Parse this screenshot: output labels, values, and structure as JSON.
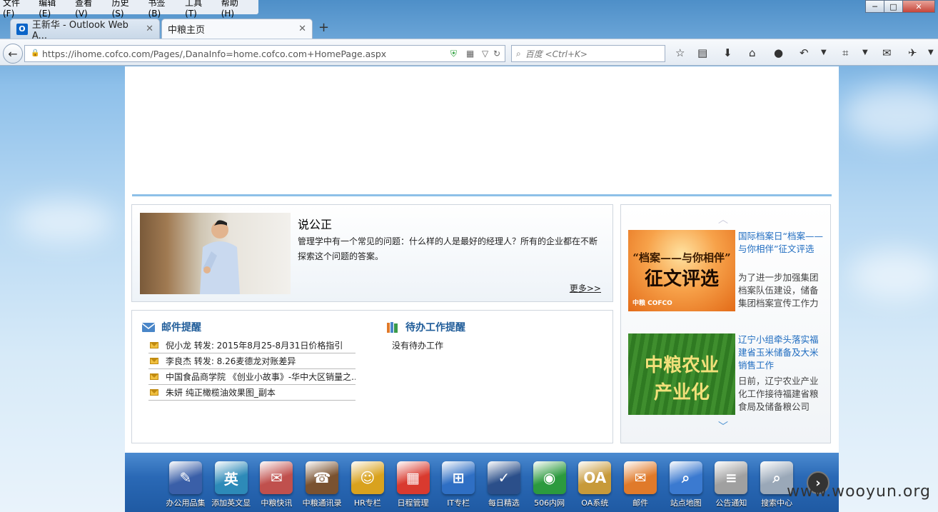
{
  "menu": [
    "文件(F)",
    "编辑(E)",
    "查看(V)",
    "历史(S)",
    "书签(B)",
    "工具(T)",
    "帮助(H)"
  ],
  "tabs": [
    {
      "label": "王新华 - Outlook Web A...",
      "icon": "outlook-icon"
    },
    {
      "label": "中粮主页"
    }
  ],
  "url": "https://ihome.cofco.com/Pages/,DanaInfo=home.cofco.com+HomePage.aspx",
  "search_placeholder": "百度 <Ctrl+K>",
  "feature": {
    "title": "说公正",
    "desc": "管理学中有一个常见的问题：什么样的人是最好的经理人？所有的企业都在不断探索这个问题的答案。",
    "more": "更多>>"
  },
  "mail": {
    "title": "邮件提醒",
    "items": [
      "倪小龙  转发: 2015年8月25-8月31日价格指引",
      "李良杰  转发: 8.26麦德龙对账差异",
      "中国食品商学院  《创业小故事》-华中大区销量之...",
      "朱妍  纯正橄榄油效果图_副本"
    ]
  },
  "todo": {
    "title": "待办工作提醒",
    "empty": "没有待办工作"
  },
  "news": [
    {
      "title": "国际档案日“档案——与你相伴”征文评选",
      "desc": "为了进一步加强集团档案队伍建设，储备集团档案宣传工作力",
      "img_text1": "“档案——与你相伴”",
      "img_text2": "征文评选",
      "brand": "中粮 COFCO"
    },
    {
      "title": "辽宁小组牵头落实福建省玉米储备及大米销售工作",
      "desc": "日前，辽宁农业产业化工作接待福建省粮食局及储备粮公司",
      "img_text1": "中粮农业",
      "img_text2": "产业化"
    }
  ],
  "dock": [
    {
      "label": "办公用品集",
      "glyph": "✎",
      "color": "#3a5fa8"
    },
    {
      "label": "添加英文显",
      "glyph": "英",
      "color": "#2d8ab8"
    },
    {
      "label": "中粮快讯",
      "glyph": "✉",
      "color": "#c0504d"
    },
    {
      "label": "中粮通讯录",
      "glyph": "☎",
      "color": "#7a5230"
    },
    {
      "label": "HR专栏",
      "glyph": "☺",
      "color": "#d9a21e"
    },
    {
      "label": "日程管理",
      "glyph": "▦",
      "color": "#d93a2f"
    },
    {
      "label": "IT专栏",
      "glyph": "⊞",
      "color": "#2f6fc4"
    },
    {
      "label": "每日精选",
      "glyph": "✓",
      "color": "#2b4f8a"
    },
    {
      "label": "506内网",
      "glyph": "◉",
      "color": "#2c9a3e"
    },
    {
      "label": "OA系统",
      "glyph": "OA",
      "color": "#c79a3a"
    },
    {
      "label": "邮件",
      "glyph": "✉",
      "color": "#e07a2a"
    },
    {
      "label": "站点地图",
      "glyph": "⌕",
      "color": "#3b7ad0"
    },
    {
      "label": "公告通知",
      "glyph": "≡",
      "color": "#a0a0a0"
    },
    {
      "label": "搜索中心",
      "glyph": "⌕",
      "color": "#9aa8b8"
    }
  ],
  "watermark": "www.wooyun.org"
}
